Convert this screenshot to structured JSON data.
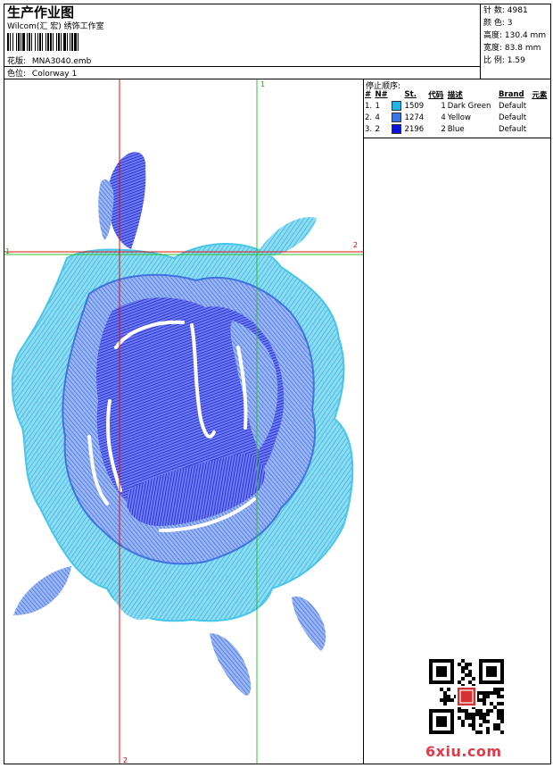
{
  "header": {
    "title": "生产作业图",
    "company": "Wilcom(汇 宏) 绣饰工作室",
    "design_file_label": "花版:",
    "design_file": "MNA3040.emb",
    "colorway_label": "色位:",
    "colorway": "Colorway 1"
  },
  "stats": {
    "stitches_label": "针 数:",
    "stitches": "4981",
    "colors_label": "颜 色:",
    "colors": "3",
    "height_label": "高度:",
    "height": "130.4 mm",
    "width_label": "宽度:",
    "width": "83.8 mm",
    "scale_label": "比 例:",
    "scale": "1.59"
  },
  "stop_sequence": {
    "title": "停止顺序:",
    "headers": [
      "#",
      "N#",
      "St.",
      "代码",
      "描述",
      "Brand",
      "元素"
    ],
    "rows": [
      {
        "num": "1.",
        "needle": "1",
        "color": "#1fb6e6",
        "stitches": "1509",
        "code": "1",
        "desc": "Dark Green",
        "brand": "Default"
      },
      {
        "num": "2.",
        "needle": "4",
        "color": "#3d74e6",
        "stitches": "1274",
        "code": "4",
        "desc": "Yellow",
        "brand": "Default"
      },
      {
        "num": "3.",
        "needle": "2",
        "color": "#0a14d8",
        "stitches": "2196",
        "code": "2",
        "desc": "Blue",
        "brand": "Default"
      }
    ]
  },
  "guides": {
    "h_marker_left": "1",
    "h_marker_right": "2",
    "v_marker_top": "1",
    "v_marker_bottom": "2"
  },
  "watermark": "6xiu.com",
  "colors": {
    "light_cyan": "#46c6e8",
    "mid_blue": "#3f73e0",
    "dark_blue": "#0b16cc",
    "guide_red": "#e01010",
    "guide_green": "#30c030"
  }
}
